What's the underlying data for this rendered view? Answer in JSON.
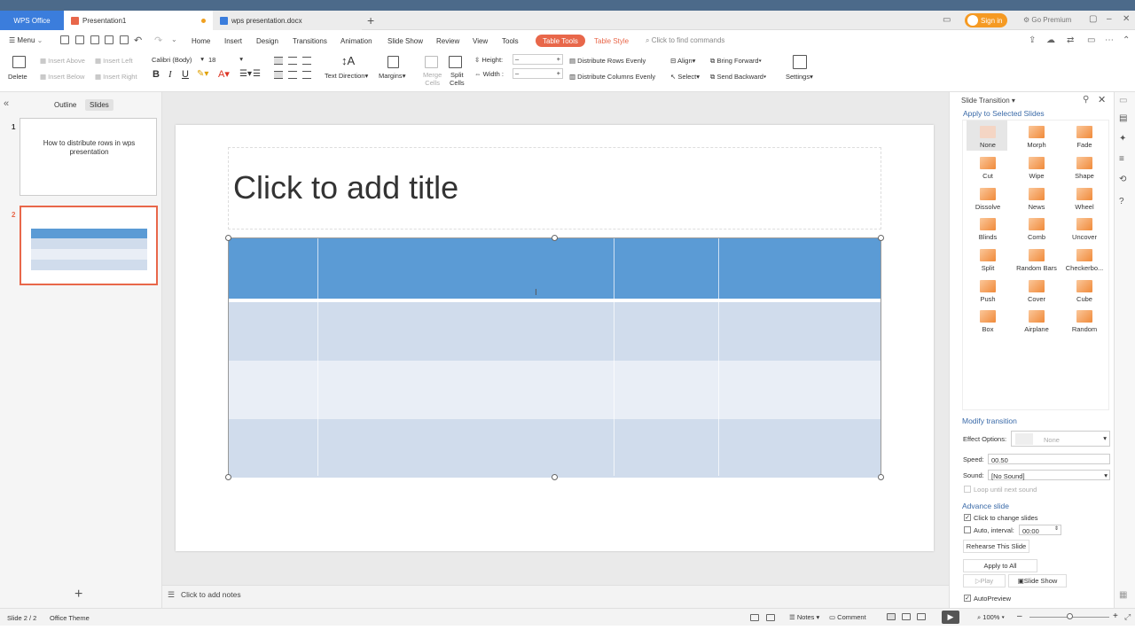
{
  "tabs": {
    "wps": "WPS Office",
    "presentation": "Presentation1",
    "document": "wps presentation.docx",
    "new_tab": "+"
  },
  "window": {
    "signin": "Sign in",
    "premium": "Go Premium"
  },
  "menu": {
    "menu_label": "Menu",
    "items": [
      "Home",
      "Insert",
      "Design",
      "Transitions",
      "Animation",
      "Slide Show",
      "Review",
      "View",
      "Tools"
    ],
    "table_tools": "Table Tools",
    "table_style": "Table Style",
    "search_placeholder": "Click to find commands"
  },
  "ribbon": {
    "delete": "Delete",
    "insert_above": "Insert Above",
    "insert_left": "Insert Left",
    "insert_below": "Insert Below",
    "insert_right": "Insert Right",
    "font": "Calibri (Body)",
    "font_size": "18",
    "text_direction": "Text Direction",
    "margins": "Margins",
    "merge": "Merge",
    "cells": "Cells",
    "split": "Split",
    "split_cells": "Cells",
    "height": "Height:",
    "width": "Width :",
    "dist_rows": "Distribute Rows Evenly",
    "dist_cols": "Distribute Columns Evenly",
    "align": "Align",
    "select": "Select",
    "bring_forward": "Bring Forward",
    "send_backward": "Send Backward",
    "settings": "Settings"
  },
  "left_panel": {
    "outline_tab": "Outline",
    "slides_tab": "Slides",
    "slides": [
      {
        "num": "1",
        "text": "How to distribute rows in wps presentation"
      },
      {
        "num": "2",
        "text": ""
      }
    ],
    "add": "+"
  },
  "slide": {
    "title_placeholder": "Click to add title",
    "table": {
      "rows": 4,
      "cols": 4
    }
  },
  "notes": {
    "placeholder": "Click to add notes"
  },
  "transition": {
    "panel_title": "Slide Transition",
    "apply_to": "Apply to Selected Slides",
    "items": [
      "None",
      "Morph",
      "Fade",
      "Cut",
      "Wipe",
      "Shape",
      "Dissolve",
      "News",
      "Wheel",
      "Blinds",
      "Comb",
      "Uncover",
      "Split",
      "Random Bars",
      "Checkerbo...",
      "Push",
      "Cover",
      "Cube",
      "Box",
      "Airplane",
      "Random"
    ],
    "selected": "None",
    "modify": "Modify transition",
    "effect_options_label": "Effect Options:",
    "effect_options_value": "None",
    "speed_label": "Speed:",
    "speed_value": "00.50",
    "sound_label": "Sound:",
    "sound_value": "[No Sound]",
    "loop": "Loop until next sound",
    "advance": "Advance slide",
    "click_change": "Click to change slides",
    "auto_interval": "Auto, interval:",
    "interval_value": "00:00",
    "rehearse": "Rehearse This Slide",
    "apply_all": "Apply to All",
    "play": "Play",
    "slide_show": "Slide Show",
    "autopreview": "AutoPreview"
  },
  "status": {
    "slide": "Slide 2 / 2",
    "theme": "Office Theme",
    "notes": "Notes",
    "comment": "Comment",
    "zoom": "100%"
  },
  "colors": {
    "accent": "#e8674a",
    "header": "#5b9bd5",
    "row_dark": "#d0dcec",
    "row_light": "#e9eef6",
    "brand": "#3b7ddc"
  }
}
